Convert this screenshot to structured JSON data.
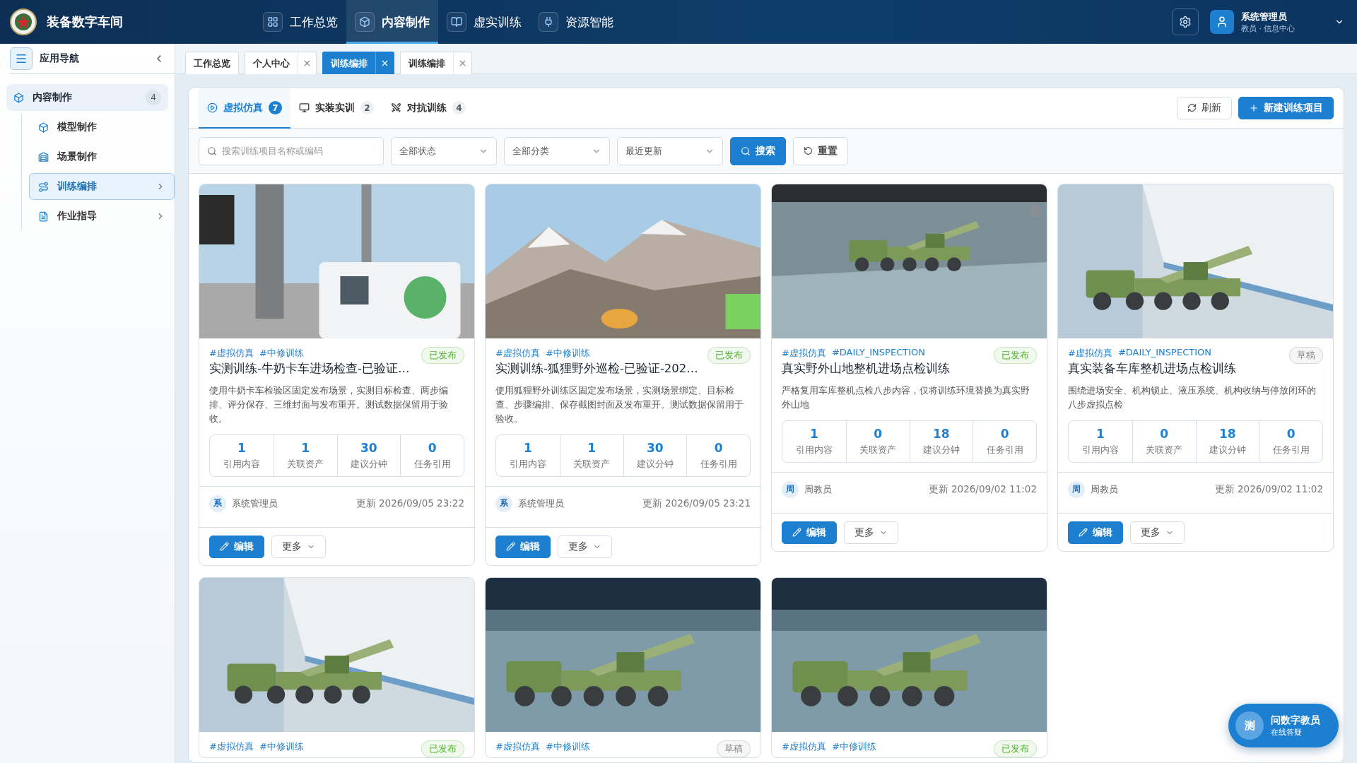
{
  "app": {
    "title": "装备数字车间"
  },
  "top_nav": [
    {
      "label": "工作总览",
      "selected": false
    },
    {
      "label": "内容制作",
      "selected": true
    },
    {
      "label": "虚实训练",
      "selected": false
    },
    {
      "label": "资源智能",
      "selected": false
    }
  ],
  "user": {
    "name": "系统管理员",
    "role": "教员 · 信息中心"
  },
  "sidebar": {
    "title": "应用导航",
    "group": {
      "label": "内容制作",
      "count": "4",
      "children": [
        {
          "label": "模型制作",
          "selected": false,
          "expandable": false
        },
        {
          "label": "场景制作",
          "selected": false,
          "expandable": false
        },
        {
          "label": "训练编排",
          "selected": true,
          "expandable": true
        },
        {
          "label": "作业指导",
          "selected": false,
          "expandable": true
        }
      ]
    }
  },
  "page_tabs": [
    {
      "label": "工作总览",
      "selected": false,
      "closable": false
    },
    {
      "label": "个人中心",
      "selected": false,
      "closable": true
    },
    {
      "label": "训练编排",
      "selected": true,
      "closable": true
    },
    {
      "label": "训练编排",
      "selected": false,
      "closable": true
    }
  ],
  "panel_tabs": [
    {
      "label": "虚拟仿真",
      "count": "7",
      "selected": true
    },
    {
      "label": "实装实训",
      "count": "2",
      "selected": false
    },
    {
      "label": "对抗训练",
      "count": "4",
      "selected": false
    }
  ],
  "actions": {
    "refresh": "刷新",
    "create": "新建训练项目"
  },
  "filters": {
    "placeholder": "搜索训练项目名称或编码",
    "selects": [
      "全部状态",
      "全部分类",
      "最近更新"
    ],
    "search": "搜索",
    "reset": "重置"
  },
  "cards": [
    {
      "tags": [
        "#虚拟仿真",
        "#中修训练"
      ],
      "status": "已发布",
      "color": "#52b330",
      "title": "实测训练-牛奶卡车进场检查-已验证…",
      "description": "使用牛奶卡车检验区固定发布场景，实测目标检查、两步编排、评分保存、三维封面与发布重开。测试数据保留用于验收。",
      "stats": [
        {
          "value": "1",
          "label": "引用内容"
        },
        {
          "value": "1",
          "label": "关联资产"
        },
        {
          "value": "30",
          "label": "建议分钟"
        },
        {
          "value": "0",
          "label": "任务引用"
        }
      ],
      "author_initial": "系",
      "author": "系统管理员",
      "updated": "更新 2026/09/05 23:22",
      "edit": "编辑",
      "more": "更多"
    },
    {
      "tags": [
        "#虚拟仿真",
        "#中修训练"
      ],
      "status": "已发布",
      "color": "#52b330",
      "title": "实测训练-狐狸野外巡检-已验证-202…",
      "description": "使用狐狸野外训练区固定发布场景，实测场景绑定、目标检查、步骤编排、保存截图封面及发布重开。测试数据保留用于验收。",
      "stats": [
        {
          "value": "1",
          "label": "引用内容"
        },
        {
          "value": "1",
          "label": "关联资产"
        },
        {
          "value": "30",
          "label": "建议分钟"
        },
        {
          "value": "0",
          "label": "任务引用"
        }
      ],
      "author_initial": "系",
      "author": "系统管理员",
      "updated": "更新 2026/09/05 23:21",
      "edit": "编辑",
      "more": "更多"
    },
    {
      "tags": [
        "#虚拟仿真",
        "#DAILY_INSPECTION"
      ],
      "status": "已发布",
      "color": "#52b330",
      "title": "真实野外山地整机进场点检训练",
      "description": "严格复用车库整机点检八步内容，仅将训练环境替换为真实野外山地",
      "stats": [
        {
          "value": "1",
          "label": "引用内容"
        },
        {
          "value": "0",
          "label": "关联资产"
        },
        {
          "value": "18",
          "label": "建议分钟"
        },
        {
          "value": "0",
          "label": "任务引用"
        }
      ],
      "author_initial": "周",
      "author": "周教员",
      "updated": "更新 2026/09/02 11:02",
      "edit": "编辑",
      "more": "更多"
    },
    {
      "tags": [
        "#虚拟仿真",
        "#DAILY_INSPECTION"
      ],
      "status": "草稿",
      "color": "#888888",
      "title": "真实装备车库整机进场点检训练",
      "description": "围绕进场安全、机构锁止、液压系统、机构收纳与停放闭环的八步虚拟点检",
      "stats": [
        {
          "value": "1",
          "label": "引用内容"
        },
        {
          "value": "0",
          "label": "关联资产"
        },
        {
          "value": "18",
          "label": "建议分钟"
        },
        {
          "value": "0",
          "label": "任务引用"
        }
      ],
      "author_initial": "周",
      "author": "周教员",
      "updated": "更新 2026/09/02 11:02",
      "edit": "编辑",
      "more": "更多"
    },
    {
      "tags": [
        "#虚拟仿真",
        "#中修训练"
      ],
      "status": "已发布",
      "color": "#52b330"
    },
    {
      "tags": [
        "#虚拟仿真",
        "#中修训练"
      ],
      "status": "草稿",
      "color": "#888888"
    },
    {
      "tags": [
        "#虚拟仿真",
        "#中修训练"
      ],
      "status": "已发布",
      "color": "#52b330"
    }
  ],
  "assistant": {
    "avatar": "测",
    "title": "问数字教员",
    "subtitle": "在线答疑"
  }
}
